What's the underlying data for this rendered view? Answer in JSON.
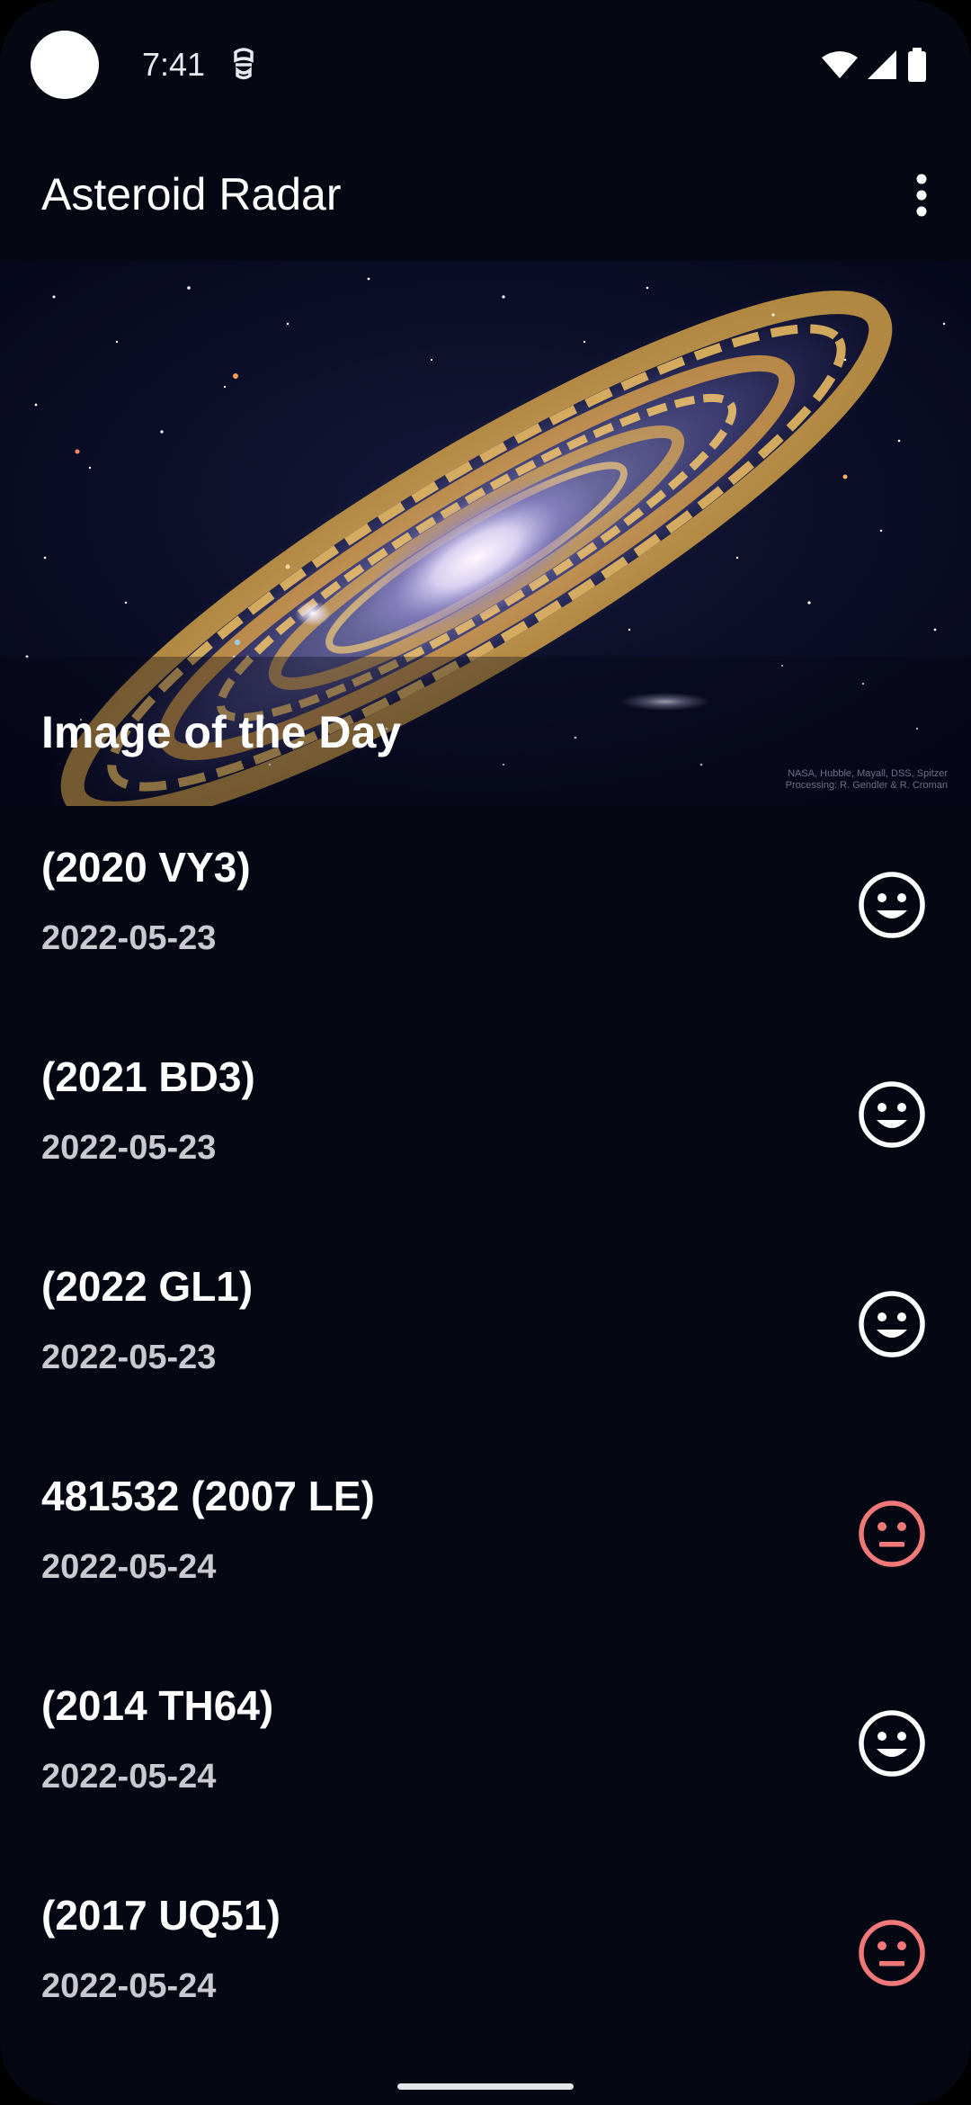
{
  "status_bar": {
    "time": "7:41"
  },
  "app_bar": {
    "title": "Asteroid Radar"
  },
  "image_of_day": {
    "label": "Image of the Day",
    "credit_line1": "NASA, Hubble, Mayall, DSS, Spitzer",
    "credit_line2": "Processing: R. Gendler & R. Croman"
  },
  "asteroids": [
    {
      "name": "(2020 VY3)",
      "date": "2022-05-23",
      "hazardous": false
    },
    {
      "name": "(2021 BD3)",
      "date": "2022-05-23",
      "hazardous": false
    },
    {
      "name": "(2022 GL1)",
      "date": "2022-05-23",
      "hazardous": false
    },
    {
      "name": "481532 (2007 LE)",
      "date": "2022-05-24",
      "hazardous": true
    },
    {
      "name": "(2014 TH64)",
      "date": "2022-05-24",
      "hazardous": false
    },
    {
      "name": "(2017 UQ51)",
      "date": "2022-05-24",
      "hazardous": true
    }
  ],
  "colors": {
    "background": "#050713",
    "safe_icon": "#ffffff",
    "hazard_icon": "#f07878",
    "date_text": "#c9c9cf"
  },
  "icons": {
    "safe": "smiley-happy-icon",
    "hazardous": "smiley-neutral-icon"
  }
}
